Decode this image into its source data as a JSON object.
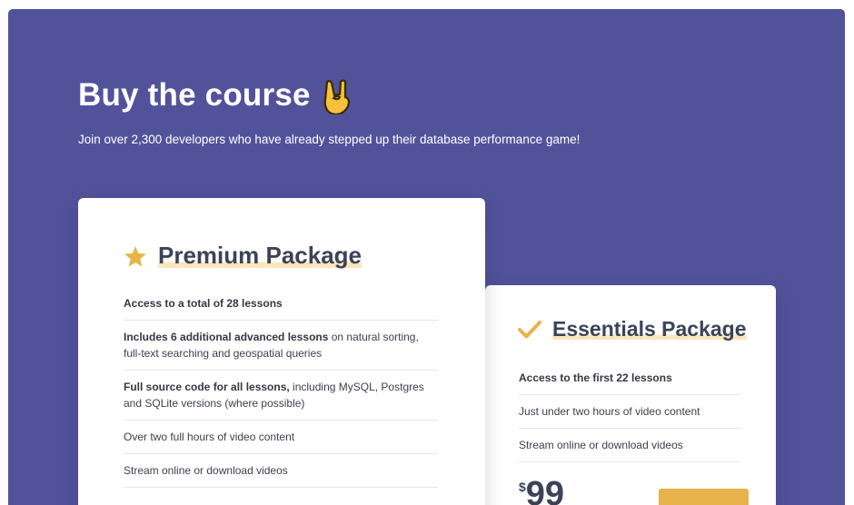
{
  "header": {
    "title": "Buy the course",
    "title_emoji_icon": "rock-on-hand-icon",
    "subtitle": "Join over 2,300 developers who have already stepped up their database performance game!"
  },
  "colors": {
    "background": "#52529b",
    "accent": "#e8b34a",
    "title_underline": "#fbe6bd",
    "heading_text": "#3b4358"
  },
  "premium": {
    "icon": "star-icon",
    "title": "Premium Package",
    "features": [
      {
        "bold": "Access to a total of 28 lessons",
        "rest": ""
      },
      {
        "bold": "Includes 6 additional advanced lessons",
        "rest": " on natural sorting, full-text searching and geospatial queries"
      },
      {
        "bold": "Full source code for all lessons,",
        "rest": " including MySQL, Postgres and SQLite versions (where possible)"
      },
      {
        "bold": "",
        "rest": "Over two full hours of video content"
      },
      {
        "bold": "",
        "rest": "Stream online or download videos"
      }
    ]
  },
  "essentials": {
    "icon": "check-icon",
    "title": "Essentials Package",
    "features": [
      {
        "bold": "Access to the first 22 lessons",
        "rest": ""
      },
      {
        "bold": "",
        "rest": "Just under two hours of video content"
      },
      {
        "bold": "",
        "rest": "Stream online or download videos"
      }
    ],
    "price_currency": "$",
    "price_amount": "99"
  }
}
